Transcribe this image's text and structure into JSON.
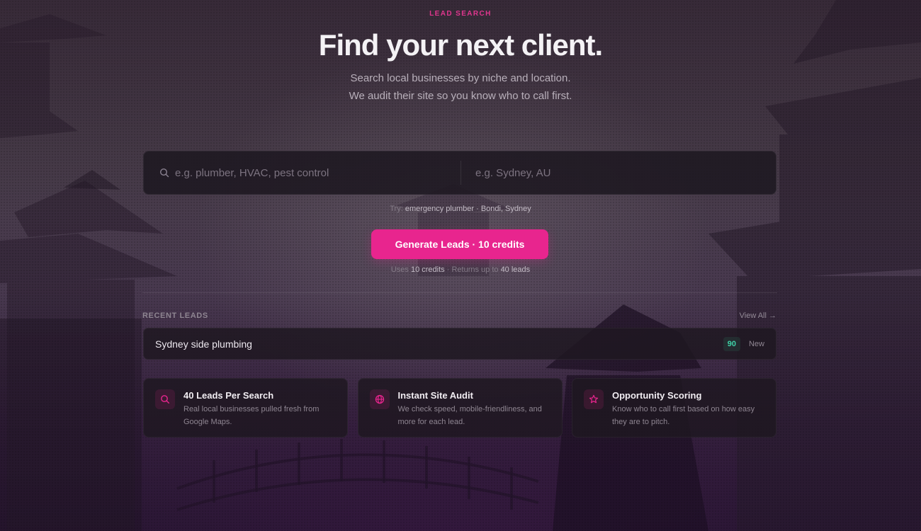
{
  "hero": {
    "eyebrow": "LEAD SEARCH",
    "title": "Find your next client.",
    "subtitle": "Search local businesses by niche and location. We audit their site so you know who to call first."
  },
  "search": {
    "niche_placeholder": "e.g. plumber, HVAC, pest control",
    "location_placeholder": "e.g. Sydney, AU",
    "niche_value": "",
    "location_value": ""
  },
  "try": {
    "label": "Try:",
    "example": "emergency plumber · Bondi, Sydney"
  },
  "cta": {
    "label": "Generate Leads · 10 credits",
    "note_prefix": "Uses",
    "note_credits": "10 credits",
    "note_mid": "· Returns up to",
    "note_leads": "40 leads"
  },
  "recent": {
    "heading": "RECENT LEADS",
    "view_all": "View All →",
    "items": [
      {
        "name": "Sydney side plumbing",
        "score": "90",
        "status": "New"
      }
    ]
  },
  "features": [
    {
      "icon": "search-icon",
      "title": "40 Leads Per Search",
      "desc": "Real local businesses pulled fresh from Google Maps."
    },
    {
      "icon": "globe-icon",
      "title": "Instant Site Audit",
      "desc": "We check speed, mobile-friendliness, and more for each lead."
    },
    {
      "icon": "star-icon",
      "title": "Opportunity Scoring",
      "desc": "Know who to call first based on how easy they are to pitch."
    }
  ],
  "colors": {
    "accent": "#e8258e",
    "score": "#3fd2a8"
  }
}
